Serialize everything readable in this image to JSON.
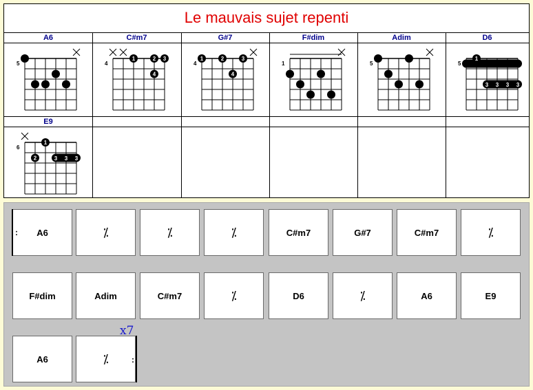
{
  "title": "Le mauvais sujet repenti",
  "chords": [
    {
      "name": "A6",
      "fret": "5",
      "muted": [
        5
      ],
      "dots": [
        [
          0,
          0,
          ""
        ],
        [
          1,
          3,
          ""
        ],
        [
          2,
          1,
          ""
        ],
        [
          2,
          2,
          ""
        ],
        [
          2,
          4,
          ""
        ]
      ],
      "barres": []
    },
    {
      "name": "C#m7",
      "fret": "4",
      "muted": [
        0,
        1
      ],
      "dots": [
        [
          0,
          2,
          "1"
        ],
        [
          0,
          4,
          "2"
        ],
        [
          0,
          5,
          "3"
        ],
        [
          1,
          4,
          "4"
        ]
      ],
      "barres": []
    },
    {
      "name": "G#7",
      "fret": "4",
      "muted": [
        5
      ],
      "dots": [
        [
          0,
          0,
          "1"
        ],
        [
          0,
          2,
          "2"
        ],
        [
          0,
          4,
          "3"
        ],
        [
          1,
          3,
          "4"
        ]
      ],
      "barres": []
    },
    {
      "name": "F#dim",
      "fret": "1",
      "muted": [
        5
      ],
      "nut": true,
      "dots": [
        [
          1,
          0,
          ""
        ],
        [
          1,
          3,
          ""
        ],
        [
          2,
          1,
          ""
        ],
        [
          3,
          2,
          ""
        ],
        [
          3,
          4,
          ""
        ]
      ],
      "barres": []
    },
    {
      "name": "Adim",
      "fret": "5",
      "muted": [
        5
      ],
      "dots": [
        [
          0,
          0,
          ""
        ],
        [
          0,
          3,
          ""
        ],
        [
          1,
          1,
          ""
        ],
        [
          2,
          2,
          ""
        ],
        [
          2,
          4,
          ""
        ]
      ],
      "barres": []
    },
    {
      "name": "D6",
      "fret": "5",
      "muted": [],
      "dots": [
        [
          0,
          1,
          "1"
        ]
      ],
      "barres": [
        [
          0,
          0,
          5,
          ""
        ],
        [
          2,
          2,
          5,
          "3"
        ]
      ]
    },
    {
      "name": "E9",
      "fret": "6",
      "muted": [
        0
      ],
      "dots": [
        [
          0,
          2,
          "1"
        ],
        [
          1,
          1,
          "2"
        ]
      ],
      "barres": [
        [
          1,
          3,
          5,
          "3"
        ]
      ]
    }
  ],
  "grid": {
    "rows": [
      [
        "A6",
        "%",
        "%",
        "%",
        "C#m7",
        "G#7",
        "C#m7",
        "%"
      ],
      [
        "F#dim",
        "Adim",
        "C#m7",
        "%",
        "D6",
        "%",
        "A6",
        "E9"
      ],
      [
        "A6",
        "%"
      ]
    ],
    "repeat_label": "x7",
    "repeat_colon": ":"
  }
}
